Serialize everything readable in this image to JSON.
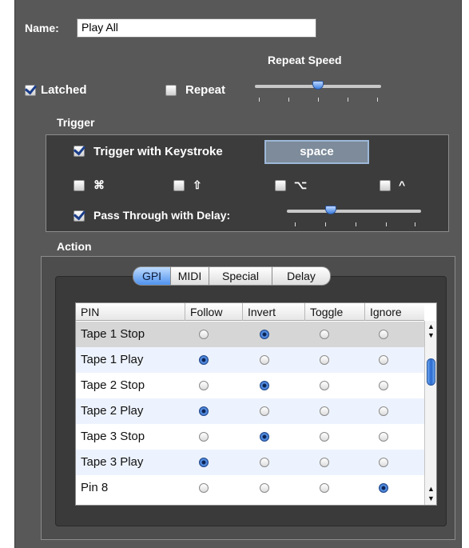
{
  "name": {
    "label": "Name:",
    "value": "Play All"
  },
  "repeat_speed": {
    "label": "Repeat Speed",
    "level": 0.5
  },
  "latched": {
    "label": "Latched",
    "checked": true
  },
  "repeat": {
    "label": "Repeat",
    "checked": false
  },
  "trigger": {
    "title": "Trigger",
    "keystroke": {
      "label": "Trigger with Keystroke",
      "checked": true,
      "key": "space"
    },
    "modifiers": [
      {
        "symbol": "⌘",
        "name": "command",
        "checked": false
      },
      {
        "symbol": "⇧",
        "name": "shift",
        "checked": false
      },
      {
        "symbol": "⌥",
        "name": "option",
        "checked": false
      },
      {
        "symbol": "^",
        "name": "control",
        "checked": false
      }
    ],
    "pass_through": {
      "label": "Pass Through with Delay:",
      "checked": true,
      "level": 0.33
    }
  },
  "action": {
    "title": "Action",
    "tabs": [
      "GPI",
      "MIDI",
      "Special",
      "Delay"
    ],
    "selected_tab": "GPI",
    "table": {
      "columns": [
        "PIN",
        "Follow",
        "Invert",
        "Toggle",
        "Ignore"
      ],
      "rows": [
        {
          "pin": "Tape 1 Stop",
          "selected": "Invert"
        },
        {
          "pin": "Tape 1 Play",
          "selected": "Follow"
        },
        {
          "pin": "Tape 2 Stop",
          "selected": "Invert"
        },
        {
          "pin": "Tape 2 Play",
          "selected": "Follow"
        },
        {
          "pin": "Tape 3 Stop",
          "selected": "Invert"
        },
        {
          "pin": "Tape 3 Play",
          "selected": "Follow"
        },
        {
          "pin": "Pin 8",
          "selected": "Ignore"
        }
      ]
    }
  },
  "colors": {
    "panel": "#585858",
    "accent": "#3d7fe0"
  }
}
